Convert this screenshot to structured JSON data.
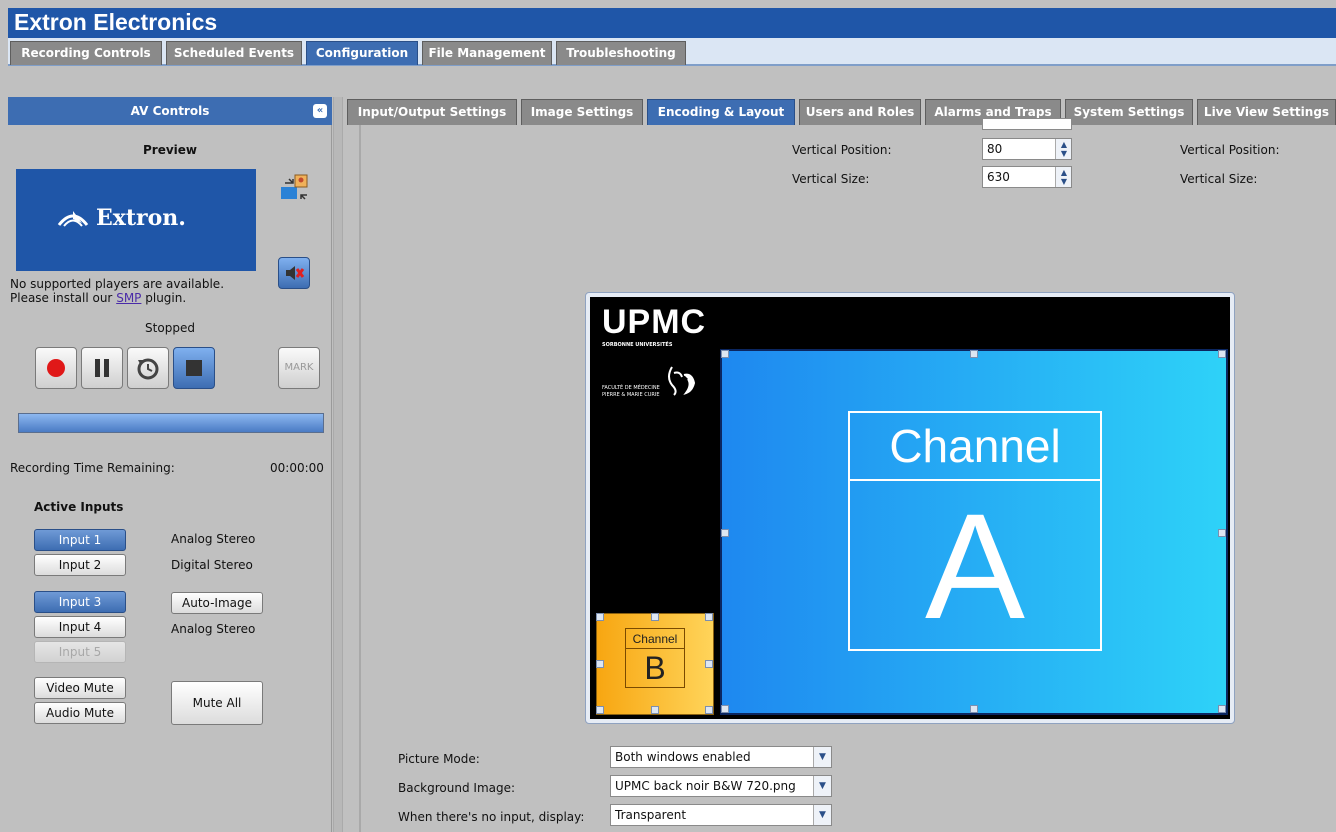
{
  "app": {
    "title": "Extron Electronics"
  },
  "main_tabs": [
    {
      "label": "Recording Controls",
      "active": false
    },
    {
      "label": "Scheduled Events",
      "active": false
    },
    {
      "label": "Configuration",
      "active": true
    },
    {
      "label": "File Management",
      "active": false
    },
    {
      "label": "Troubleshooting",
      "active": false
    }
  ],
  "av_controls": {
    "header": "AV Controls",
    "collapse_glyph": "«",
    "preview_label": "Preview",
    "logo_text": "Extron.",
    "player_msg_line1": "No supported players are available.",
    "player_msg_line2_prefix": "Please install our",
    "player_msg_link": "SMP",
    "player_msg_line2_suffix": "plugin.",
    "status": "Stopped",
    "mark_label": "MARK",
    "time_remaining_label": "Recording Time Remaining:",
    "time_remaining_value": "00:00:00",
    "progress": 1.0,
    "active_inputs_title": "Active Inputs",
    "inputs": [
      {
        "label": "Input 1",
        "selected": true,
        "disabled": false
      },
      {
        "label": "Input 2",
        "selected": false,
        "disabled": false
      },
      {
        "label": "Input 3",
        "selected": true,
        "disabled": false
      },
      {
        "label": "Input 4",
        "selected": false,
        "disabled": false
      },
      {
        "label": "Input 5",
        "selected": false,
        "disabled": true
      }
    ],
    "input_audio_1": "Analog Stereo",
    "input_audio_2": "Digital Stereo",
    "input_audio_4": "Analog Stereo",
    "auto_image": "Auto-Image",
    "video_mute": "Video Mute",
    "audio_mute": "Audio Mute",
    "mute_all": "Mute All"
  },
  "config_tabs": [
    {
      "label": "Input/Output Settings",
      "active": false
    },
    {
      "label": "Image Settings",
      "active": false
    },
    {
      "label": "Encoding & Layout",
      "active": true
    },
    {
      "label": "Users and Roles",
      "active": false
    },
    {
      "label": "Alarms and Traps",
      "active": false
    },
    {
      "label": "System Settings",
      "active": false
    },
    {
      "label": "Live View Settings",
      "active": false
    }
  ],
  "layout": {
    "vpos_label": "Vertical Position:",
    "vpos_value": "80",
    "vsize_label": "Vertical Size:",
    "vsize_value": "630",
    "vpos_label_b": "Vertical Position:",
    "vsize_label_b": "Vertical Size:",
    "picture_mode_label": "Picture Mode:",
    "picture_mode_value": "Both windows enabled",
    "background_image_label": "Background Image:",
    "background_image_value": "UPMC back noir B&W 720.png",
    "no_input_label": "When there's no input, display:",
    "no_input_value": "Transparent"
  },
  "canvas": {
    "logo_text": "UPMC",
    "logo_subtitle": "SORBONNE UNIVERSITÉS",
    "faculty_line1": "FACULTÉ DE MÉDECINE",
    "faculty_line2": "PIERRE & MARIE CURIE",
    "channel_a_word": "Channel",
    "channel_a_letter": "A",
    "channel_b_word": "Channel",
    "channel_b_letter": "B"
  }
}
